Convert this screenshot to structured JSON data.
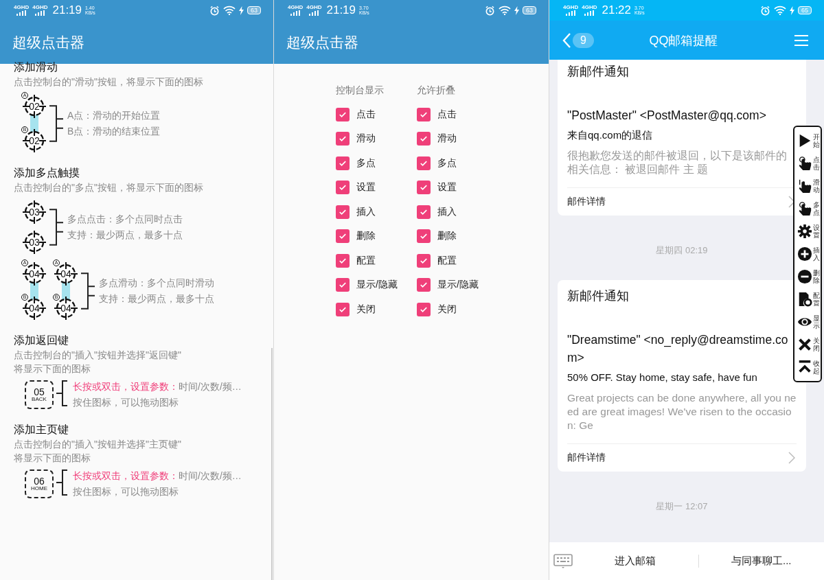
{
  "screens": [
    {
      "kind": "guide",
      "status_bar": {
        "sims": [
          "4GHD",
          "4GHD"
        ],
        "time": "21:19",
        "speed": [
          "1.40",
          "KB/s"
        ],
        "battery": "63"
      },
      "app_bar": {
        "title": "超级点击器"
      },
      "sections": [
        {
          "title": "添加滑动",
          "desc": [
            "点击控制台的\"滑动\"按钮，将显示下面的图标"
          ],
          "figures": [
            {
              "kind": "swipe",
              "pairs": [
                {
                  "start": {
                    "number": "02",
                    "mark": "A"
                  },
                  "end": {
                    "number": "02",
                    "mark": "B"
                  }
                }
              ],
              "lines": [
                {
                  "text": "A点：滑动的开始位置"
                },
                {
                  "text": "B点：滑动的结束位置"
                }
              ]
            }
          ]
        },
        {
          "title": "添加多点触摸",
          "desc": [
            "点击控制台的\"多点\"按钮，将显示下面的图标"
          ],
          "figures": [
            {
              "kind": "tap",
              "numbers": [
                "03",
                "03"
              ],
              "lines": [
                {
                  "text": "多点点击：多个点同时点击"
                },
                {
                  "text": "支持：最少两点，最多十点"
                }
              ]
            },
            {
              "kind": "swipe",
              "pairs": [
                {
                  "start": {
                    "number": "04",
                    "mark": "A"
                  },
                  "end": {
                    "number": "04",
                    "mark": "B"
                  }
                },
                {
                  "start": {
                    "number": "04",
                    "mark": "A"
                  },
                  "end": {
                    "number": "04",
                    "mark": "B"
                  }
                }
              ],
              "lines": [
                {
                  "text": "多点滑动：多个点同时滑动"
                },
                {
                  "text": "支持：最少两点，最多十点"
                }
              ]
            }
          ]
        },
        {
          "title": "添加返回键",
          "desc": [
            "点击控制台的\"插入\"按钮并选择\"返回键\"",
            "将显示下面的图标"
          ],
          "figures": [
            {
              "kind": "key",
              "numbers": [
                "05"
              ],
              "caption": "BACK",
              "lines": [
                {
                  "highlight": "长按或双击，设置参数：",
                  "text": "时间/次数/频…"
                },
                {
                  "text": "按住图标，可以拖动图标"
                }
              ]
            }
          ]
        },
        {
          "title": "添加主页键",
          "desc": [
            "点击控制台的\"插入\"按钮并选择\"主页键\"",
            "将显示下面的图标"
          ],
          "figures": [
            {
              "kind": "key",
              "numbers": [
                "06"
              ],
              "caption": "HOME",
              "lines": [
                {
                  "highlight": "长按或双击，设置参数：",
                  "text": "时间/次数/频…"
                },
                {
                  "text": "按住图标，可以拖动图标"
                }
              ]
            }
          ]
        }
      ]
    },
    {
      "kind": "settings",
      "status_bar": {
        "sims": [
          "4GHD",
          "4GHD"
        ],
        "time": "21:19",
        "speed": [
          "3.70",
          "KB/s"
        ],
        "battery": "63"
      },
      "app_bar": {
        "title": "超级点击器"
      },
      "columns": [
        {
          "heading": "控制台显示",
          "items": [
            {
              "label": "点击",
              "checked": true
            },
            {
              "label": "滑动",
              "checked": true
            },
            {
              "label": "多点",
              "checked": true
            },
            {
              "label": "设置",
              "checked": true
            },
            {
              "label": "插入",
              "checked": true
            },
            {
              "label": "删除",
              "checked": true
            },
            {
              "label": "配置",
              "checked": true
            },
            {
              "label": "显示/隐藏",
              "checked": true
            },
            {
              "label": "关闭",
              "checked": true
            }
          ]
        },
        {
          "heading": "允许折叠",
          "items": [
            {
              "label": "点击",
              "checked": true
            },
            {
              "label": "滑动",
              "checked": true
            },
            {
              "label": "多点",
              "checked": true
            },
            {
              "label": "设置",
              "checked": true
            },
            {
              "label": "插入",
              "checked": true
            },
            {
              "label": "删除",
              "checked": true
            },
            {
              "label": "配置",
              "checked": true
            },
            {
              "label": "显示/隐藏",
              "checked": true
            },
            {
              "label": "关闭",
              "checked": true
            }
          ]
        }
      ]
    },
    {
      "kind": "mail",
      "status_bar": {
        "sims": [
          "4GHD",
          "4GHD"
        ],
        "time": "21:22",
        "speed": [
          "3.70",
          "KB/s"
        ],
        "battery": "65"
      },
      "app_bar": {
        "title": "QQ邮箱提醒",
        "back_count": "9"
      },
      "feed": [
        {
          "kind": "card",
          "heading": "新邮件通知",
          "sender": "\"PostMaster\" <PostMaster@qq.com>",
          "subject": "来自qq.com的退信",
          "preview": " 很抱歉您发送的邮件被退回，以下是该邮件的相关信息： 被退回邮件 主 题",
          "details": "邮件详情"
        },
        {
          "kind": "time",
          "text": "星期四 02:19"
        },
        {
          "kind": "card",
          "heading": "新邮件通知",
          "sender": "\"Dreamstime\" <no_reply@dreamstime.com>",
          "subject": "50% OFF. Stay home, stay safe, have fun",
          "preview": " Great projects can be done anywhere, all you need are great images! We've risen to the occasion: Ge",
          "details": "邮件详情"
        },
        {
          "kind": "time",
          "text": "星期一 12:07"
        }
      ],
      "bottom_bar": [
        "进入邮箱",
        "与同事聊工..."
      ],
      "floating_toolbar": [
        {
          "label": "开始"
        },
        {
          "label": "点击"
        },
        {
          "label": "滑动"
        },
        {
          "label": "多点"
        },
        {
          "label": "设置"
        },
        {
          "label": "插入"
        },
        {
          "label": "删除"
        },
        {
          "label": "配置"
        },
        {
          "label": "显示"
        },
        {
          "label": "关闭"
        },
        {
          "label": "收起"
        }
      ]
    }
  ]
}
